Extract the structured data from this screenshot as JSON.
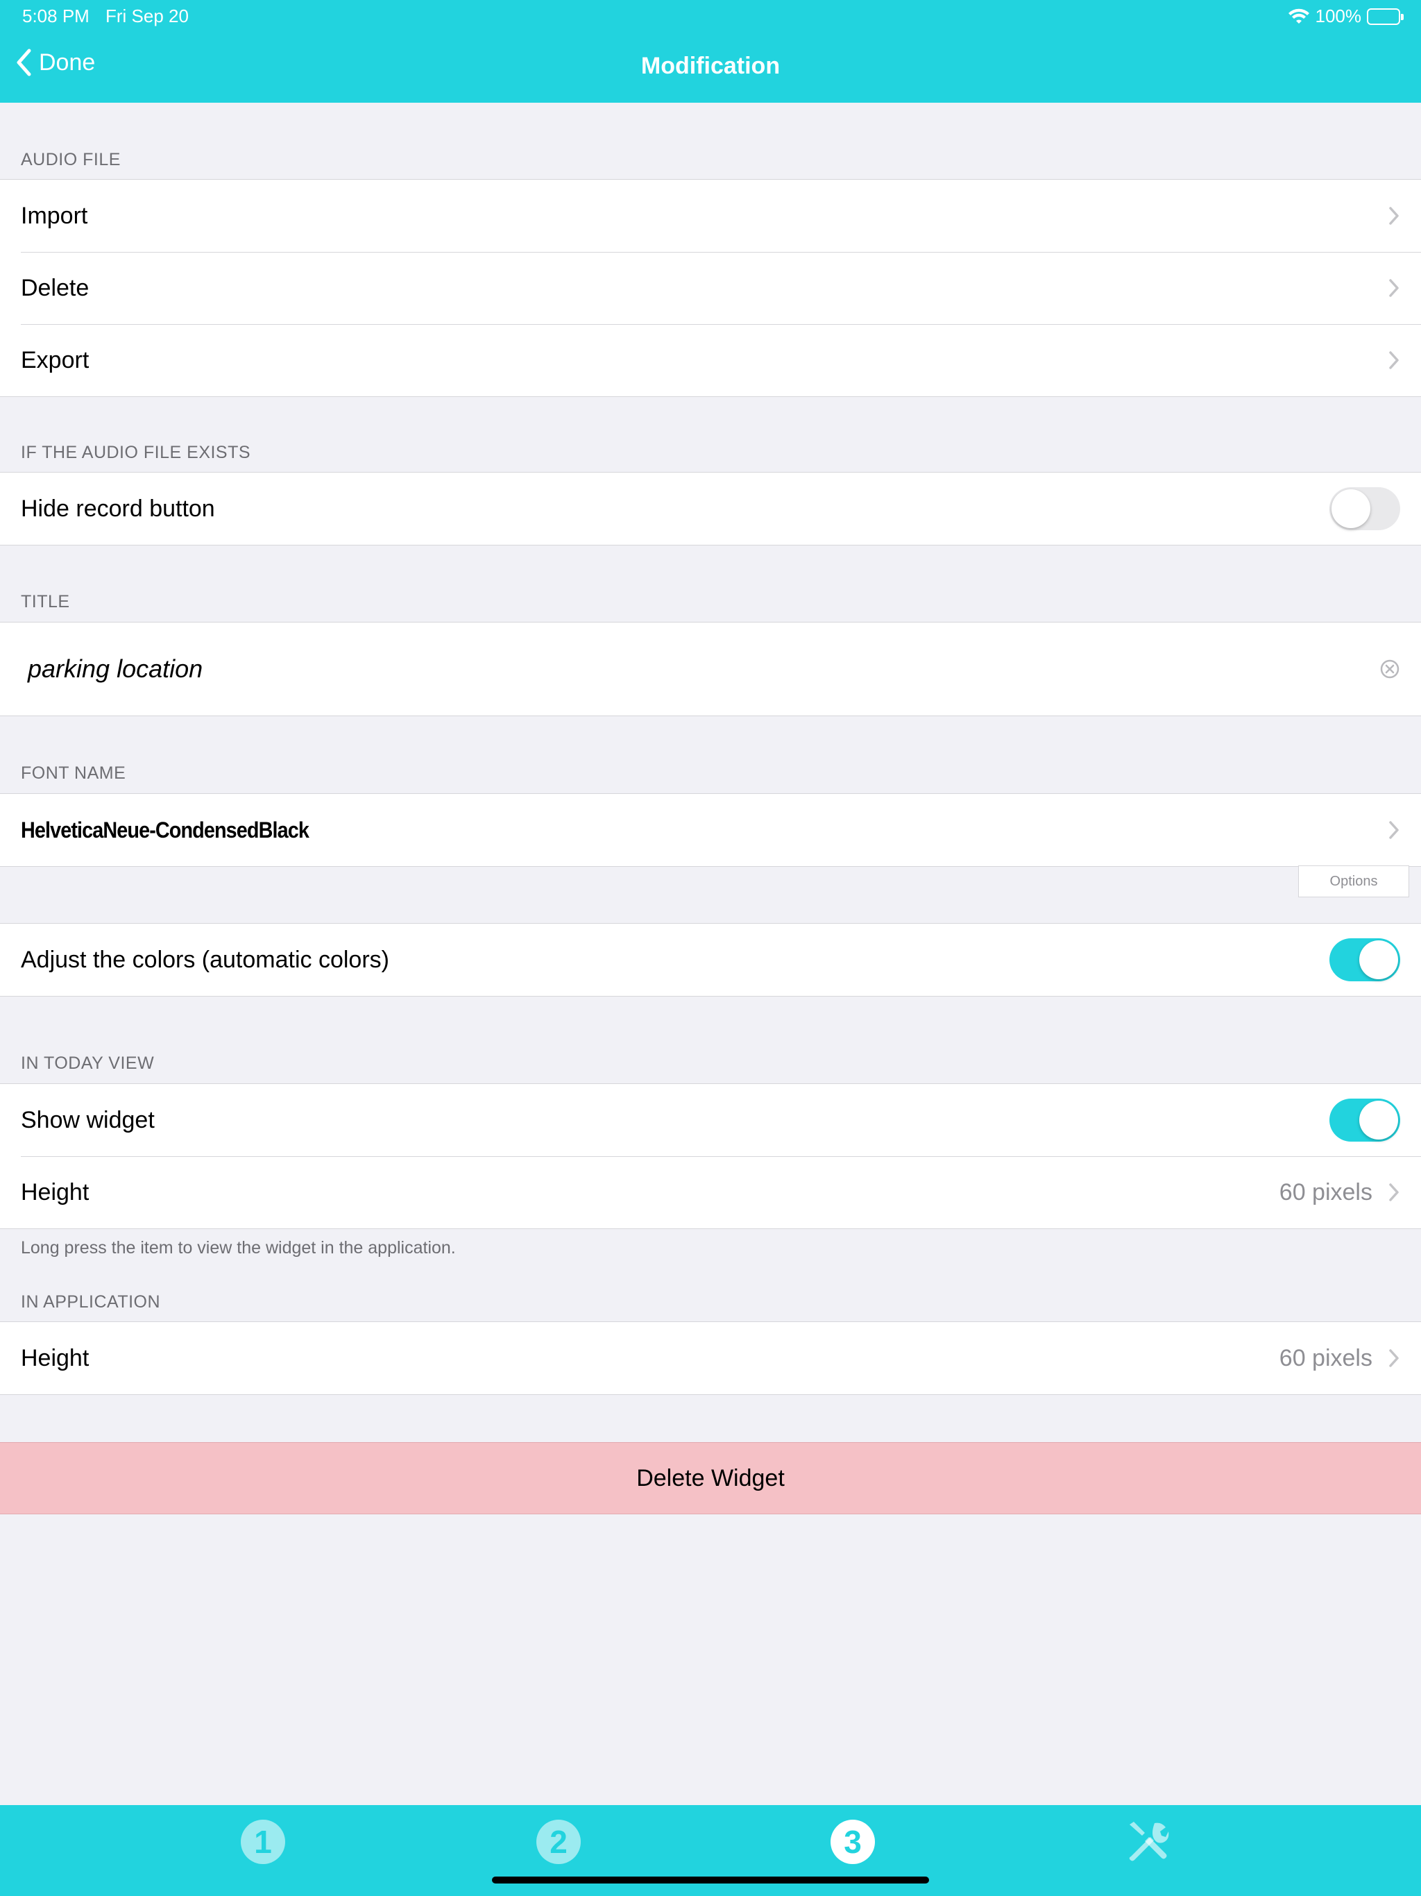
{
  "status_bar": {
    "time": "5:08 PM",
    "date": "Fri Sep 20",
    "battery": "100%"
  },
  "nav": {
    "back_label": "Done",
    "title": "Modification"
  },
  "audio_file": {
    "header": "AUDIO FILE",
    "rows": [
      "Import",
      "Delete",
      "Export"
    ]
  },
  "if_exists": {
    "header": "IF THE AUDIO FILE EXISTS",
    "hide_record_label": "Hide record button",
    "hide_record_on": false
  },
  "title_section": {
    "header": "TITLE",
    "value": "parking location"
  },
  "font_section": {
    "header": "FONT NAME",
    "value": "HelveticaNeue-CondensedBlack",
    "options_label": "Options"
  },
  "colors": {
    "label": "Adjust the colors (automatic colors)",
    "on": true
  },
  "today_view": {
    "header": "IN TODAY VIEW",
    "show_widget_label": "Show widget",
    "show_widget_on": true,
    "height_label": "Height",
    "height_value": "60 pixels",
    "footer": "Long press the item to view the widget in the application."
  },
  "in_application": {
    "header": "IN APPLICATION",
    "height_label": "Height",
    "height_value": "60 pixels"
  },
  "delete_widget_label": "Delete Widget",
  "tabbar": {
    "tabs": [
      "1",
      "2",
      "3"
    ],
    "active_index": 2,
    "tools_icon": "tools-icon"
  },
  "colors_palette": {
    "accent": "#22d3de",
    "delete_bg": "#f5c1c6"
  }
}
